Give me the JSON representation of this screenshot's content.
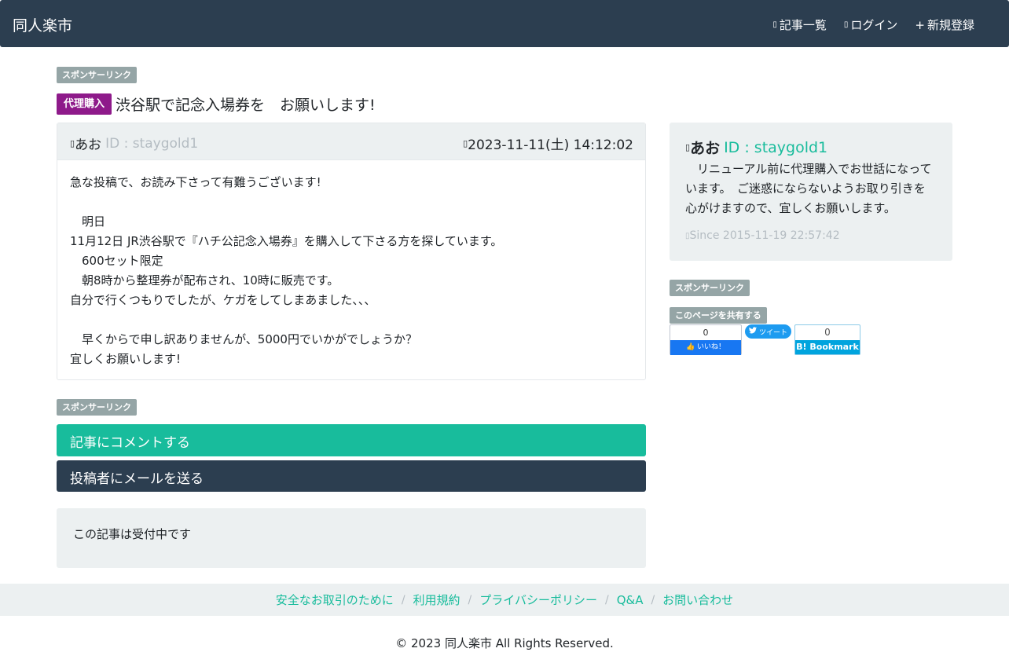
{
  "navbar": {
    "brand": "同人楽市",
    "links": [
      {
        "icon": "list-icon",
        "glyph": "▯",
        "label": "記事一覧"
      },
      {
        "icon": "login-icon",
        "glyph": "▯",
        "label": "ログイン"
      },
      {
        "icon": "plus-icon",
        "glyph": "+",
        "label": "新規登録"
      }
    ]
  },
  "sponsor_label": "スポンサーリンク",
  "post": {
    "category": "代理購入",
    "title": "渋谷駅で記念入場券を　お願いします!",
    "author_glyph": "▯",
    "author": "あお",
    "author_id": "ID : staygold1",
    "date_glyph": "▯",
    "date": "2023-11-11(土) 14:12:02",
    "body_lines": [
      "急な投稿で、お読み下さって有難うございます!",
      "",
      "　明日",
      "11月12日 JR渋谷駅で『ハチ公記念入場券』を購入して下さる方を探しています。",
      "　600セット限定",
      "　朝8時から整理券が配布され、10時に販売です。",
      "自分で行くつもりでしたが、ケガをしてしまあました、、、",
      "",
      "　早くからで申し訳ありませんが、5000円でいかがでしょうか？",
      "宜しくお願いします!"
    ]
  },
  "actions": {
    "comment_label": "記事にコメントする",
    "mail_label": "投稿者にメールを送る"
  },
  "status_text": "この記事は受付中です",
  "profile": {
    "glyph": "▯",
    "name": "あお",
    "id": "ID : staygold1",
    "description": "　リニューアル前に代理購入でお世話になっています。　ご迷惑にならないようお取り引きを心がけますので、宜しくお願いします。",
    "since_glyph": "▯",
    "since": "Since 2015-11-19 22:57:42"
  },
  "share": {
    "label": "このページを共有する",
    "fb_count": "0",
    "fb_label": "いいね！",
    "tw_label": "ツイート",
    "hb_count": "0",
    "hb_label": "B! Bookmark"
  },
  "footer": {
    "links": [
      "安全なお取引のために",
      "利用規約",
      "プライバシーポリシー",
      "Q&A",
      "お問い合わせ"
    ],
    "separator": "/",
    "copyright": "© 2023 同人楽市 All Rights Reserved."
  },
  "colors": {
    "navbar": "#2c3e50",
    "accent": "#18bc9c",
    "category": "#8e1a8a",
    "badge": "#95a5a6",
    "panel": "#ecf0f1"
  }
}
